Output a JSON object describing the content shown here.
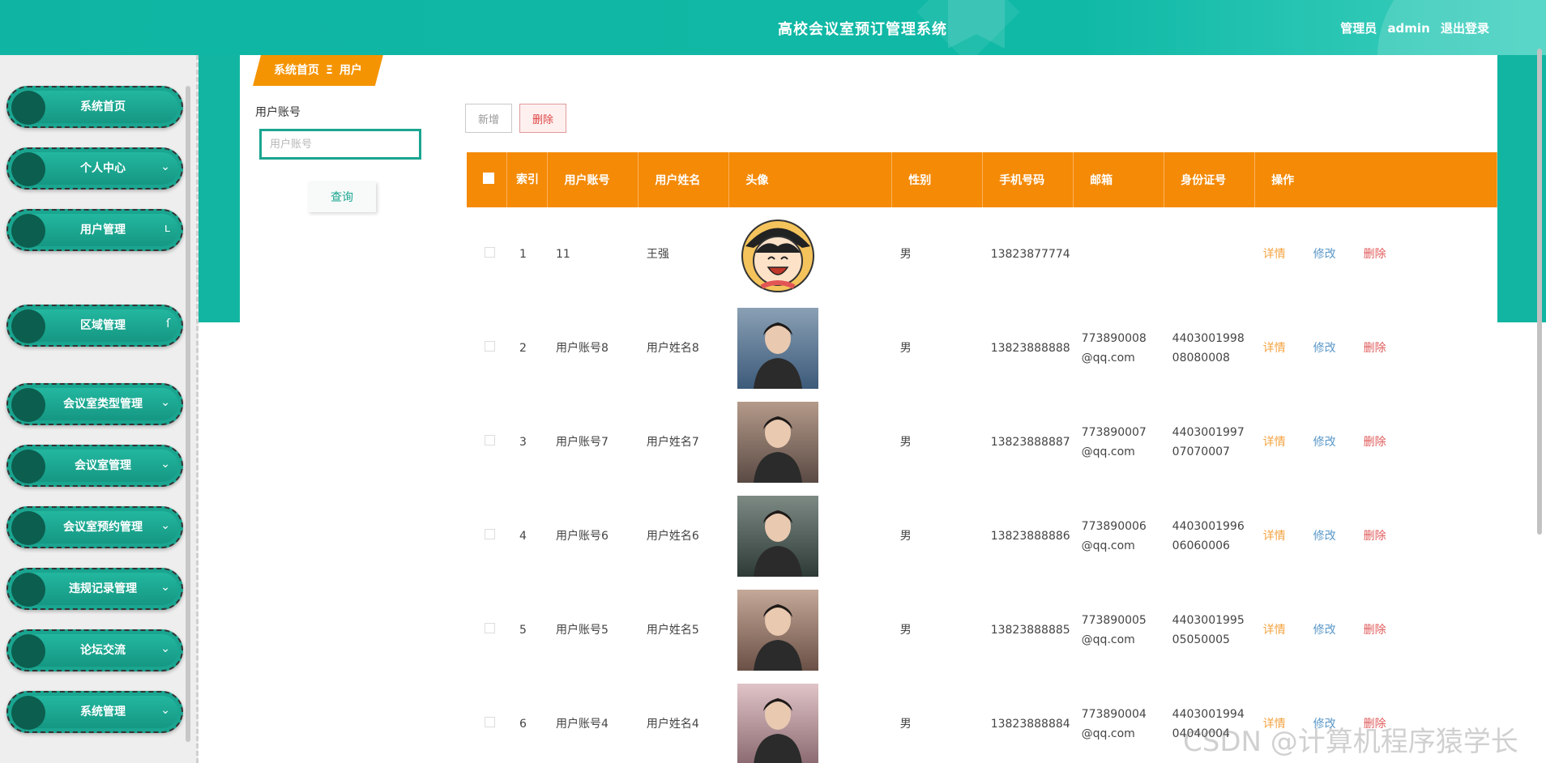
{
  "header": {
    "title": "高校会议室预订管理系统",
    "user_prefix": "管理员",
    "username": "admin",
    "logout": "退出登录"
  },
  "sidebar": {
    "items": [
      {
        "label": "系统首页",
        "icon": "chevron-none"
      },
      {
        "label": "个人中心",
        "icon": "chevron-down-icon"
      },
      {
        "label": "用户管理",
        "icon": "chevron-up-icon"
      },
      {
        "label": "区域管理",
        "icon": "chevron-up-icon"
      },
      {
        "label": "会议室类型管理",
        "icon": "chevron-down-icon"
      },
      {
        "label": "会议室管理",
        "icon": "chevron-down-icon"
      },
      {
        "label": "会议室预约管理",
        "icon": "chevron-down-icon"
      },
      {
        "label": "违规记录管理",
        "icon": "chevron-down-icon"
      },
      {
        "label": "论坛交流",
        "icon": "chevron-down-icon"
      },
      {
        "label": "系统管理",
        "icon": "chevron-down-icon"
      }
    ],
    "submenu_user": "用户"
  },
  "breadcrumb": {
    "home": "系统首页",
    "separator": "Ξ",
    "current": "用户"
  },
  "search": {
    "label": "用户账号",
    "placeholder": "用户账号",
    "button": "查询"
  },
  "toolbar": {
    "add_label": "新增",
    "delete_label": "删除"
  },
  "table": {
    "headers": {
      "index": "索引",
      "account": "用户账号",
      "name": "用户姓名",
      "avatar": "头像",
      "gender": "性别",
      "phone": "手机号码",
      "email": "邮箱",
      "idcard": "身份证号",
      "actions": "操作"
    },
    "action_labels": {
      "detail": "详情",
      "edit": "修改",
      "delete": "删除"
    },
    "rows": [
      {
        "index": "1",
        "account": "11",
        "name": "王强",
        "gender": "男",
        "phone": "13823877774",
        "email": "",
        "idcard": "",
        "avatar": "cartoon"
      },
      {
        "index": "2",
        "account": "用户账号8",
        "name": "用户姓名8",
        "gender": "男",
        "phone": "13823888888",
        "email": "773890008@qq.com",
        "idcard": "440300199808080008",
        "avatar": "photo"
      },
      {
        "index": "3",
        "account": "用户账号7",
        "name": "用户姓名7",
        "gender": "男",
        "phone": "13823888887",
        "email": "773890007@qq.com",
        "idcard": "440300199707070007",
        "avatar": "photo"
      },
      {
        "index": "4",
        "account": "用户账号6",
        "name": "用户姓名6",
        "gender": "男",
        "phone": "13823888886",
        "email": "773890006@qq.com",
        "idcard": "440300199606060006",
        "avatar": "photo"
      },
      {
        "index": "5",
        "account": "用户账号5",
        "name": "用户姓名5",
        "gender": "男",
        "phone": "13823888885",
        "email": "773890005@qq.com",
        "idcard": "440300199505050005",
        "avatar": "photo"
      },
      {
        "index": "6",
        "account": "用户账号4",
        "name": "用户姓名4",
        "gender": "男",
        "phone": "13823888884",
        "email": "773890004@qq.com",
        "idcard": "440300199404040004",
        "avatar": "photo"
      }
    ]
  },
  "watermark": "CSDN @计算机程序猿学长",
  "colors": {
    "primary": "#1aa590",
    "header": "#10b9a6",
    "table_header": "#f48a06",
    "breadcrumb": "#f59402"
  }
}
